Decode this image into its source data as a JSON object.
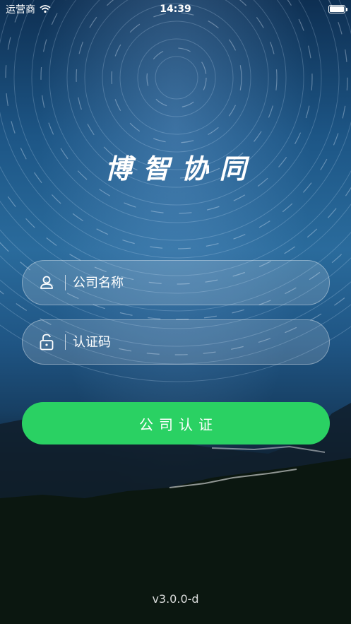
{
  "status_bar": {
    "carrier": "运营商",
    "time": "14:39"
  },
  "app": {
    "title": "博智协同"
  },
  "form": {
    "company_placeholder": "公司名称",
    "code_placeholder": "认证码",
    "submit_label": "公司认证"
  },
  "footer": {
    "version": "v3.0.0-d"
  },
  "colors": {
    "accent": "#2ad163"
  }
}
